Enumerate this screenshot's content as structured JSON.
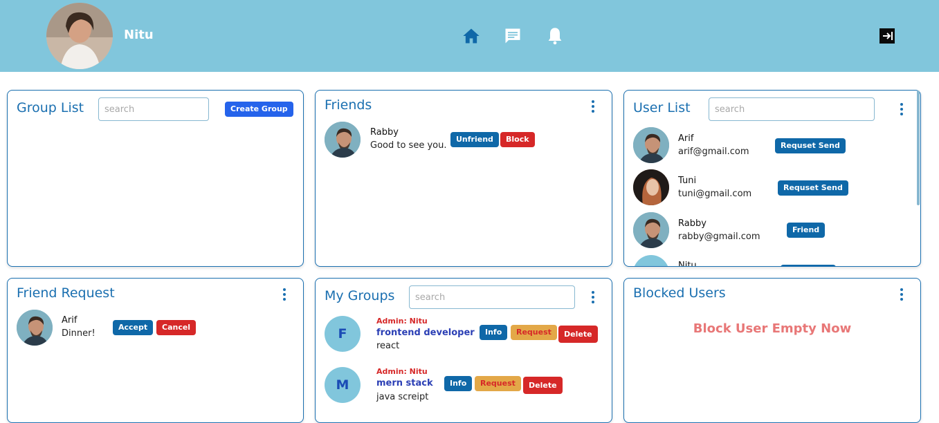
{
  "header": {
    "user_name": "Nitu",
    "nav_icons": [
      "home-icon",
      "chat-icon",
      "bell-icon"
    ],
    "logout_icon": "logout-icon"
  },
  "group_list": {
    "title": "Group List",
    "search_placeholder": "search",
    "create_label": "Create Group"
  },
  "friends": {
    "title": "Friends",
    "items": [
      {
        "name": "Rabby",
        "message": "Good to see you.",
        "unfriend_label": "Unfriend",
        "block_label": "Block"
      }
    ]
  },
  "user_list": {
    "title": "User List",
    "search_placeholder": "search",
    "items": [
      {
        "name": "Arif",
        "email": "arif@gmail.com",
        "action": "Requset Send"
      },
      {
        "name": "Tuni",
        "email": "tuni@gmail.com",
        "action": "Requset Send"
      },
      {
        "name": "Rabby",
        "email": "rabby@gmail.com",
        "action": "Friend"
      },
      {
        "name": "Nitu",
        "email": "",
        "action": ""
      }
    ]
  },
  "friend_request": {
    "title": "Friend Request",
    "items": [
      {
        "name": "Arif",
        "message": "Dinner!",
        "accept_label": "Accept",
        "cancel_label": "Cancel"
      }
    ]
  },
  "my_groups": {
    "title": "My Groups",
    "search_placeholder": "search",
    "items": [
      {
        "letter": "F",
        "admin": "Admin: Nitu",
        "name": "frontend developer",
        "tag": "react",
        "info_label": "Info",
        "request_label": "Request",
        "delete_label": "Delete"
      },
      {
        "letter": "M",
        "admin": "Admin: Nitu",
        "name": "mern stack",
        "tag": "java screipt",
        "info_label": "Info",
        "request_label": "Request",
        "delete_label": "Delete"
      }
    ]
  },
  "blocked_users": {
    "title": "Blocked Users",
    "empty_message": "Block User Empty Now"
  },
  "colors": {
    "header_bg": "#81c6dc",
    "primary": "#1a6fb0",
    "danger": "#d62828",
    "warning": "#e3a848"
  }
}
